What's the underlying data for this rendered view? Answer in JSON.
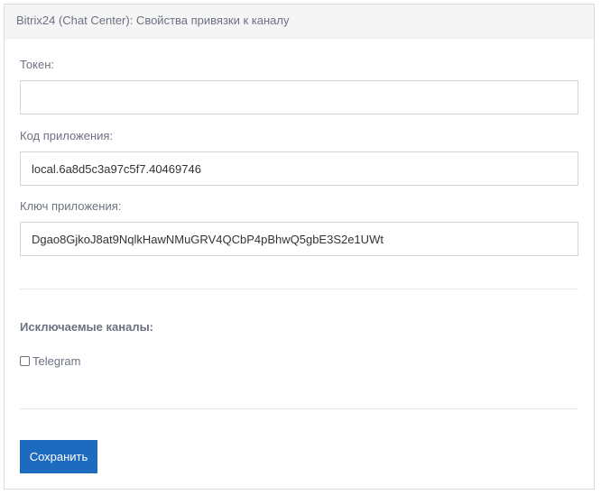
{
  "panel": {
    "title": "Bitrix24 (Chat Center): Свойства привязки к каналу"
  },
  "form": {
    "token_label": "Токен:",
    "token_value": "",
    "app_code_label": "Код приложения:",
    "app_code_value": "local.6a8d5c3a97c5f7.40469746",
    "app_key_label": "Ключ приложения:",
    "app_key_value": "Dgao8GjkoJ8at9NqlkHawNMuGRV4QCbP4pBhwQ5gbE3S2e1UWt",
    "excluded_channels_title": "Исключаемые каналы:",
    "channels": [
      {
        "label": "Telegram",
        "checked": false
      }
    ],
    "save_label": "Сохранить"
  },
  "colors": {
    "accent": "#1d6bbf",
    "header_bg": "#f5f5f5",
    "muted_text": "#6b7280",
    "border": "#d1d5db"
  }
}
